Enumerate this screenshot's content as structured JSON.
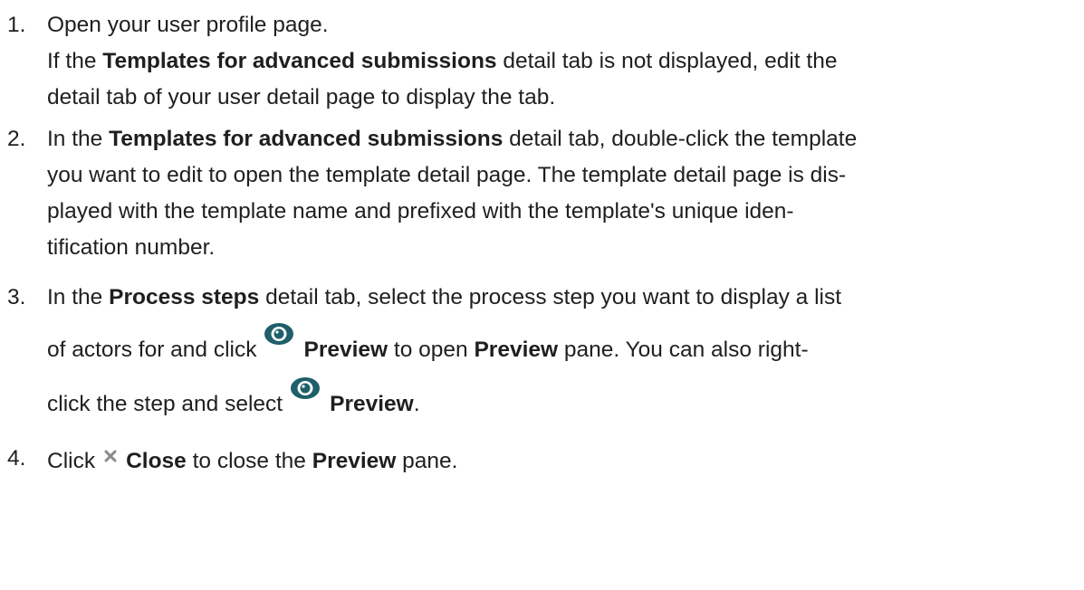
{
  "steps": [
    {
      "number": "1.",
      "text_main": "Open your user profile page.",
      "sub_before": "If the ",
      "sub_bold": "Templates for advanced submissions",
      "sub_after_line1": " detail tab is not displayed, edit the",
      "sub_line2": "detail tab of your user detail page to display the tab."
    },
    {
      "number": "2.",
      "lines": [
        {
          "before": "In the ",
          "bold": "Templates for advanced submissions",
          "after": " detail tab, double-click the template"
        },
        {
          "text": "you want to edit to open the template detail page. The template detail page is dis-"
        },
        {
          "text": "played with the template name and prefixed with the template's unique iden-"
        },
        {
          "text": "tification number."
        }
      ]
    },
    {
      "number": "3.",
      "line1_before": "In the ",
      "line1_bold": "Process steps",
      "line1_after": " detail tab, select the process step you want to display a list",
      "line2_before": "of actors for and click",
      "line2_bold1": "Preview",
      "line2_mid": " to open ",
      "line2_bold2": "Preview",
      "line2_after": " pane. You can also right-",
      "line3_before": "click the step and select",
      "line3_bold": "Preview",
      "line3_after": "."
    },
    {
      "number": "4.",
      "before": "Click",
      "bold1": "Close",
      "mid": " to close the ",
      "bold2": "Preview",
      "after": " pane."
    }
  ],
  "icons": {
    "preview": "eye-icon",
    "close": "close-x-icon"
  },
  "colors": {
    "text": "#1f1f1f",
    "eye_icon": "#1e5f6b",
    "close_icon": "#8a8a8a"
  }
}
